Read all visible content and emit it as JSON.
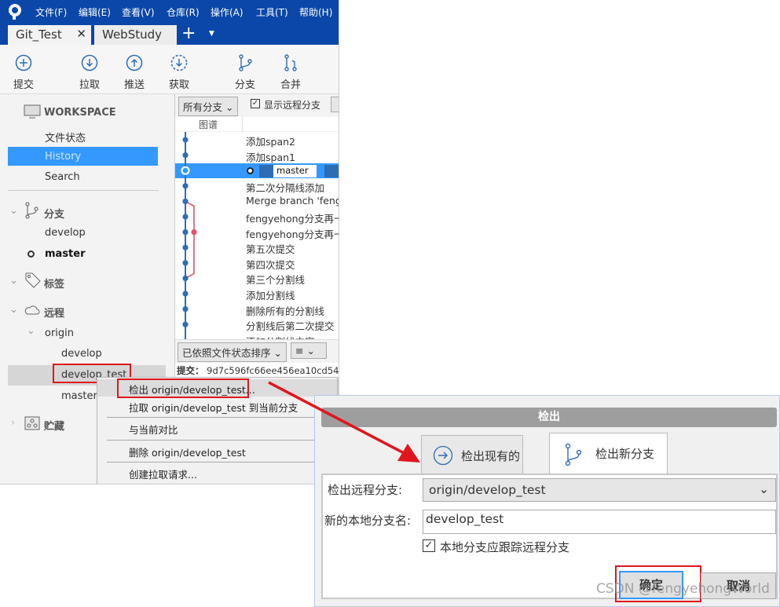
{
  "menu": [
    "文件(F)",
    "编辑(E)",
    "查看(V)",
    "仓库(R)",
    "操作(A)",
    "工具(T)",
    "帮助(H)"
  ],
  "tabs": [
    "Git_Test",
    "WebStudy"
  ],
  "toolbar": [
    "提交",
    "拉取",
    "推送",
    "获取",
    "分支",
    "合并"
  ],
  "sidebar": {
    "workspace": "WORKSPACE",
    "file_status": "文件状态",
    "history": "History",
    "search": "Search",
    "branches": "分支",
    "develop": "develop",
    "master": "master",
    "tags": "标签",
    "remotes": "远程",
    "origin": "origin",
    "remote_develop": "develop",
    "remote_develop_test": "develop_test",
    "remote_master": "master",
    "stashes": "贮藏"
  },
  "graph": {
    "branch_filter": "所有分支",
    "show_remote": "显示远程分支",
    "header": "图谱",
    "commits": [
      "添加span2",
      "添加span1",
      "",
      "第二次分隔线添加",
      "Merge branch 'feng",
      "fengyehong分支再一",
      "fengyehong分支再一",
      "第五次提交",
      "第四次提交",
      "第三个分割线",
      "添加分割线",
      "删除所有的分割线",
      "分割线后第二次提交",
      "添加分割线内容"
    ],
    "head_label": "master",
    "sort": "已依照文件状态排序",
    "commit_label": "提交：",
    "commit_hash": "9d7c596fc66ee456ea10cd54"
  },
  "context_menu": [
    "检出 origin/develop_test...",
    "拉取 origin/develop_test 到当前分支",
    "与当前对比",
    "删除 origin/develop_test",
    "创建拉取请求..."
  ],
  "dialog": {
    "title": "检出",
    "tab_existing": "检出现有的",
    "tab_new": "检出新分支",
    "remote_label": "检出远程分支:",
    "remote_value": "origin/develop_test",
    "local_label": "新的本地分支名:",
    "local_value": "develop_test",
    "track_label": "本地分支应跟踪远程分支",
    "ok": "确定",
    "cancel": "取消"
  },
  "watermark": "CSDN @fengyehongWorld",
  "colors": {
    "accent": "#0a47a9",
    "selection": "#3399ff",
    "branch": "#2e6db4",
    "merge": "#e8506b",
    "highlight": "#e0161c"
  }
}
